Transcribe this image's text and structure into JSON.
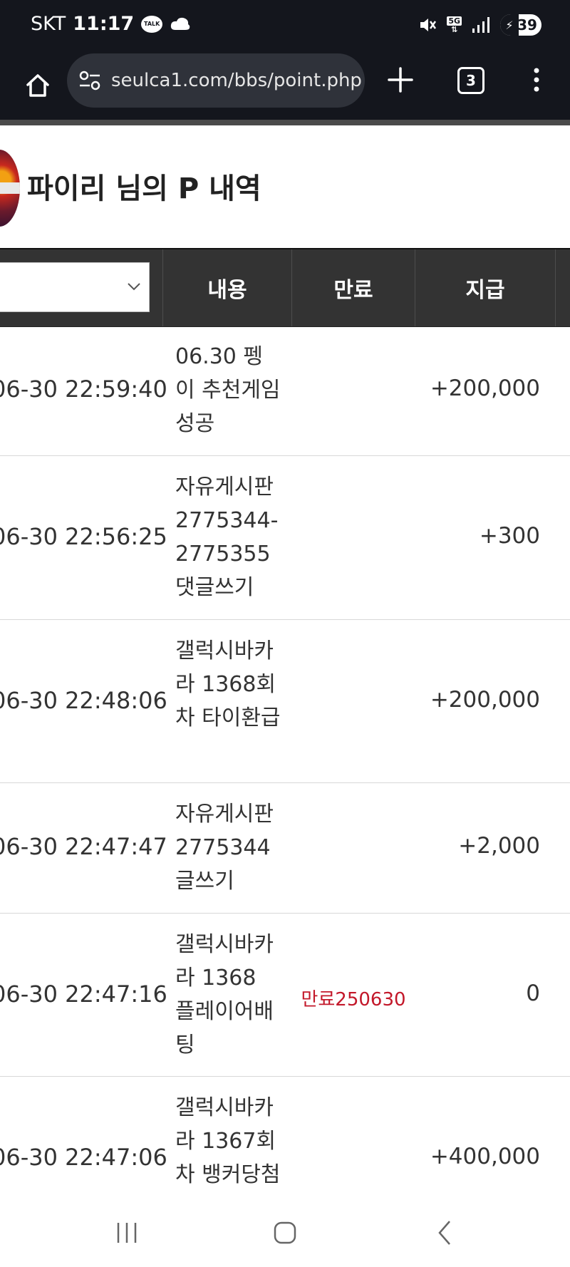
{
  "status_bar": {
    "carrier": "SKT",
    "time": "11:17",
    "talk_badge": "TALK",
    "network": "5G",
    "battery": "39"
  },
  "browser": {
    "url": "seulca1.com/bbs/point.php",
    "tab_count": "3"
  },
  "page": {
    "title": "파이리 님의 P 내역"
  },
  "table": {
    "headers": {
      "content": "내용",
      "expire": "만료",
      "paid": "지급"
    },
    "rows": [
      {
        "date": "06-30 22:59:40",
        "content": "06.30 펭이 추천게임 성공",
        "expire": "",
        "amount": "+200,000"
      },
      {
        "date": "06-30 22:56:25",
        "content": "자유게시판 2775344-2775355 댓글쓰기",
        "expire": "",
        "amount": "+300"
      },
      {
        "date": "06-30 22:48:06",
        "content": "갤럭시바카라 1368회차 타이환급",
        "expire": "",
        "amount": "+200,000"
      },
      {
        "date": "06-30 22:47:47",
        "content": "자유게시판 2775344 글쓰기",
        "expire": "",
        "amount": "+2,000"
      },
      {
        "date": "06-30 22:47:16",
        "content": "갤럭시바카라 1368 플레이어배팅",
        "expire": "만료250630",
        "amount": "0"
      },
      {
        "date": "06-30 22:47:06",
        "content": "갤럭시바카라 1367회차 뱅커당첨",
        "expire": "",
        "amount": "+400,000"
      }
    ]
  },
  "colors": {
    "header_bg": "#333333",
    "expire_text": "#c3182a",
    "chrome_bg": "#14161d"
  }
}
